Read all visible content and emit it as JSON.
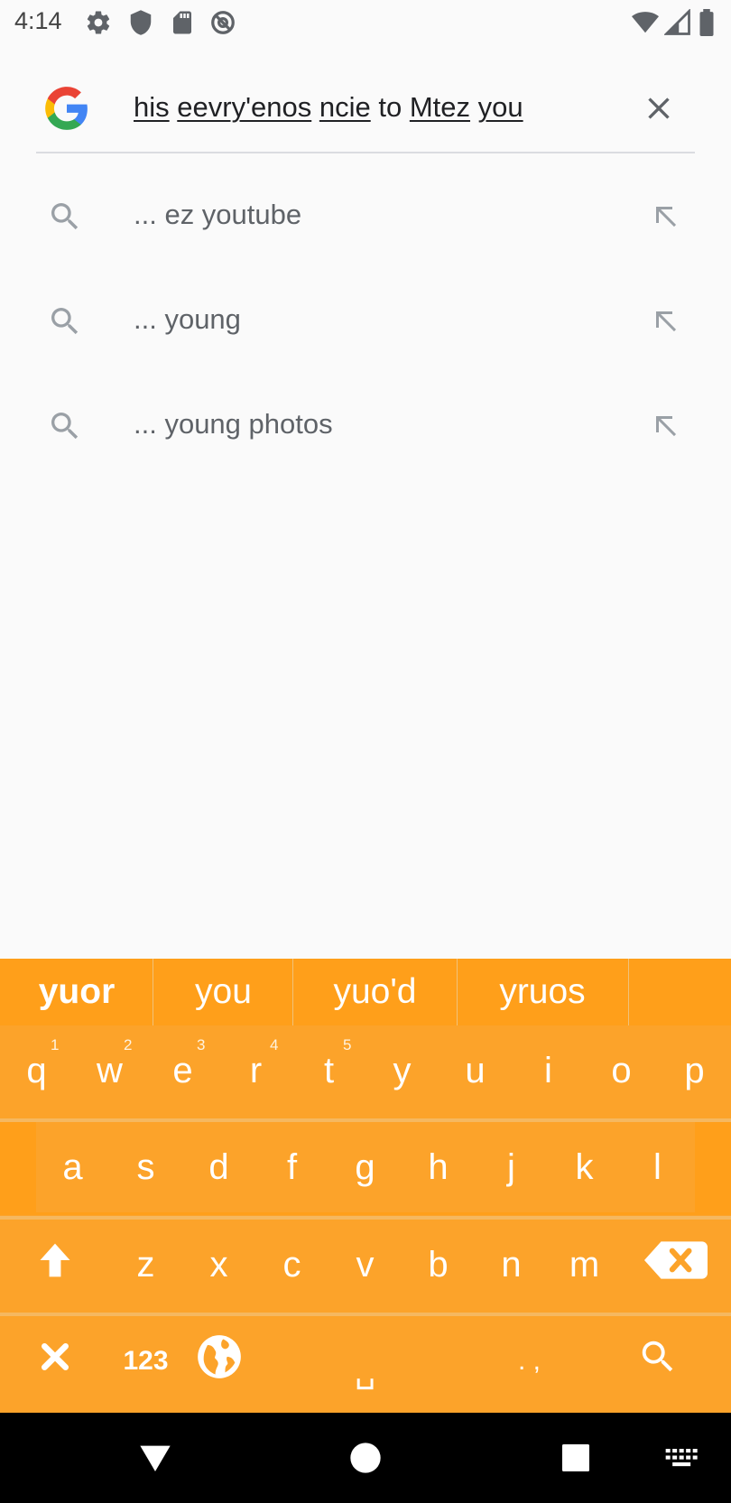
{
  "status_bar": {
    "time": "4:14",
    "icons": [
      "gear-icon",
      "shield-icon",
      "sd-card-icon",
      "at-sign-icon",
      "wifi-icon",
      "cell-signal-icon",
      "battery-icon"
    ]
  },
  "search": {
    "query_words": [
      "his",
      "eevry'enos",
      "ncie",
      "to",
      "Mtez",
      "you"
    ],
    "query_underlined": [
      true,
      true,
      true,
      false,
      true,
      true
    ]
  },
  "suggestions": [
    {
      "text": "... ez youtube"
    },
    {
      "text": "... young"
    },
    {
      "text": "... young photos"
    }
  ],
  "keyboard": {
    "candidates": [
      "yuor",
      "you",
      "yuo'd",
      "yruos"
    ],
    "row1": [
      "q",
      "w",
      "e",
      "r",
      "t",
      "y",
      "u",
      "i",
      "o",
      "p"
    ],
    "row1_hints": [
      "1",
      "2",
      "3",
      "4",
      "5"
    ],
    "row2": [
      "a",
      "s",
      "d",
      "f",
      "g",
      "h",
      "j",
      "k",
      "l"
    ],
    "row3": [
      "z",
      "x",
      "c",
      "v",
      "b",
      "n",
      "m"
    ],
    "numbers_label": "123",
    "space_label": "␣",
    "punct_label": ". ,"
  },
  "colors": {
    "keyboard_bg": "#fca32a",
    "candidate_bg": "#ff9f1a",
    "page_bg": "#fafafa"
  }
}
